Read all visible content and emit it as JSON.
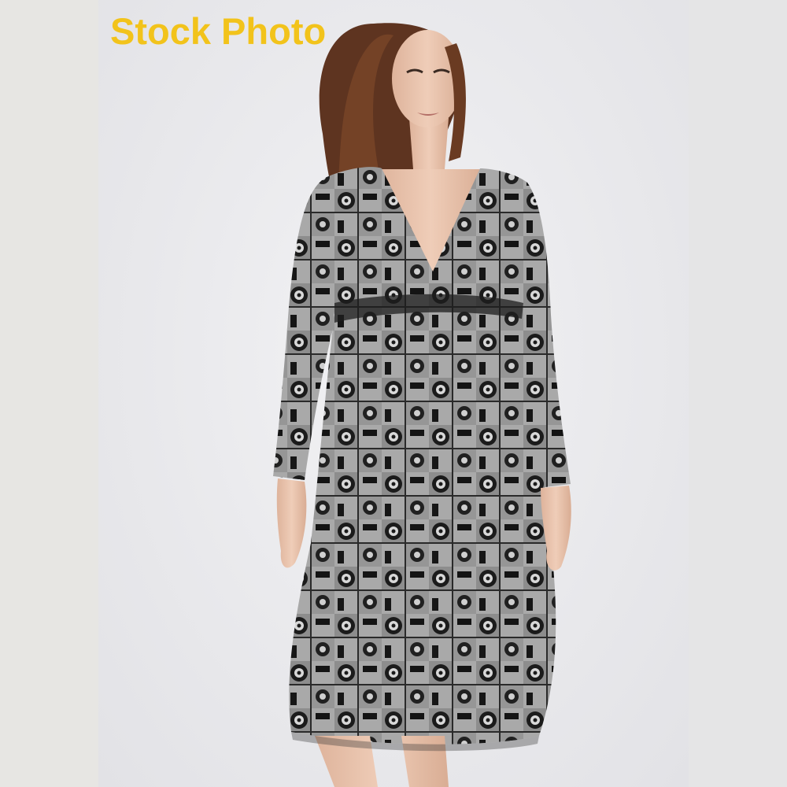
{
  "watermark": {
    "text": "Stock Photo",
    "color": "#f2c31b"
  },
  "image": {
    "icon": "product-photo",
    "colors": {
      "background": "#ececec",
      "dress_dark": "#1c1c1c",
      "dress_light": "#b9b9b9",
      "hair": "#6a3b22",
      "skin": "#e9c1aa"
    }
  }
}
